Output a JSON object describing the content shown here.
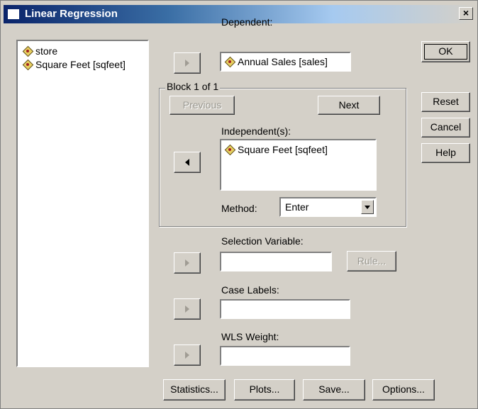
{
  "window": {
    "title": "Linear Regression",
    "close_glyph": "×"
  },
  "source_list": [
    {
      "label": "store",
      "icon": "scale-variable-icon"
    },
    {
      "label": "Square Feet [sqfeet]",
      "icon": "scale-variable-icon"
    }
  ],
  "dependent": {
    "label": "Dependent:",
    "value": "Annual Sales [sales]"
  },
  "block": {
    "label": "Block 1 of 1",
    "previous_label": "Previous",
    "next_label": "Next",
    "independents_label": "Independent(s):",
    "independents": [
      "Square Feet [sqfeet]"
    ],
    "method_label": "Method:",
    "method_value": "Enter"
  },
  "selection_variable": {
    "label": "Selection Variable:",
    "value": "",
    "rule_label": "Rule..."
  },
  "case_labels": {
    "label": "Case Labels:",
    "value": ""
  },
  "wls_weight": {
    "label": "WLS Weight:",
    "value": ""
  },
  "side_buttons": {
    "ok": "OK",
    "reset": "Reset",
    "cancel": "Cancel",
    "help": "Help"
  },
  "bottom_buttons": {
    "statistics": "Statistics...",
    "plots": "Plots...",
    "save": "Save...",
    "options": "Options..."
  }
}
